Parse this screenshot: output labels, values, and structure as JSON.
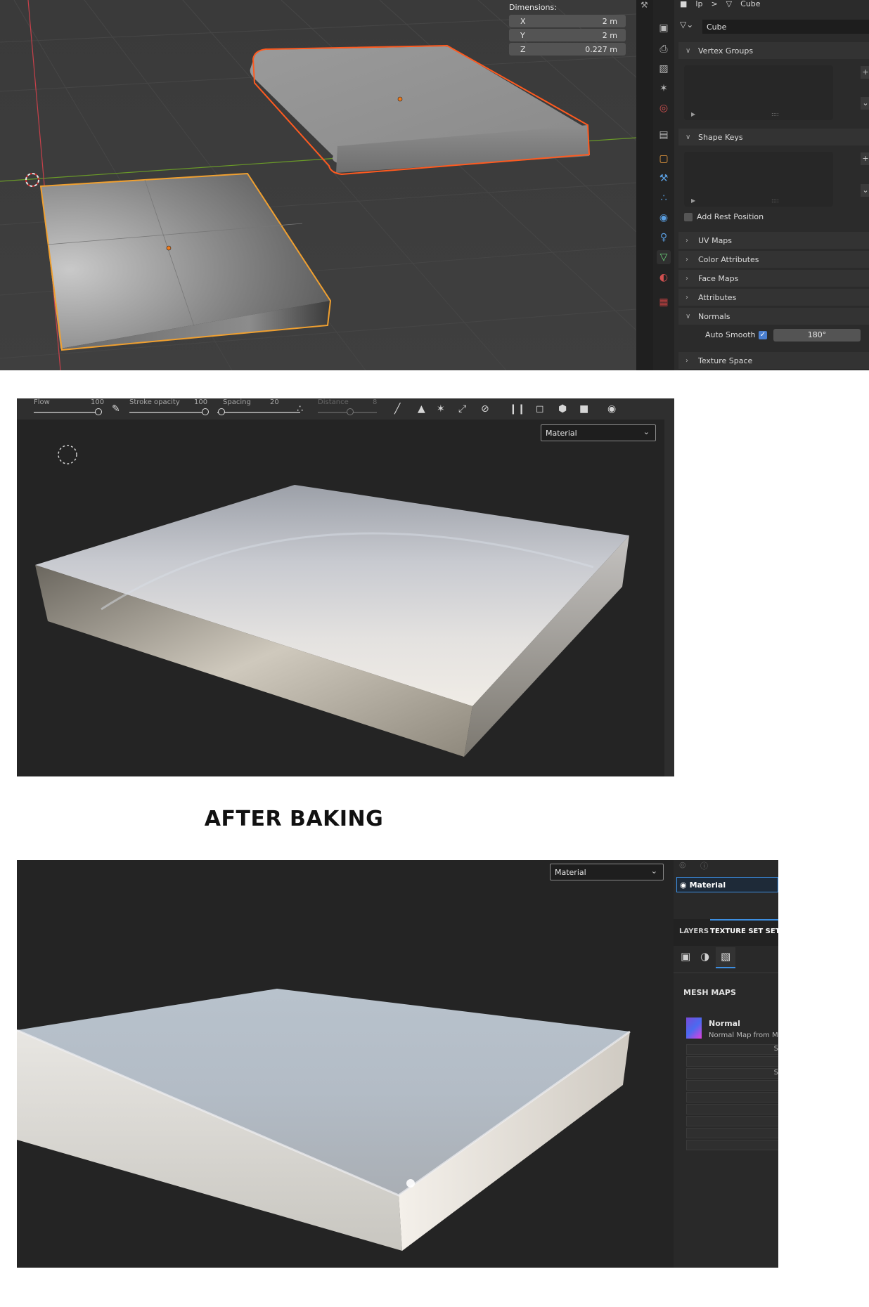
{
  "blender": {
    "dimensions": {
      "label": "Dimensions:",
      "rows": [
        {
          "axis": "X",
          "value": "2 m"
        },
        {
          "axis": "Y",
          "value": "2 m"
        },
        {
          "axis": "Z",
          "value": "0.227 m"
        }
      ]
    },
    "breadcrumb": {
      "object": "lp",
      "separator": ">",
      "data": "Cube"
    },
    "mesh_name": "Cube",
    "tab_icons": [
      "tool-icon",
      "render-icon",
      "output-icon",
      "view-layer-icon",
      "scene-icon",
      "world-icon",
      "collection-icon",
      "object-icon",
      "modifier-icon",
      "particles-icon",
      "physics-icon",
      "constraints-icon",
      "data-icon",
      "material-icon",
      "texture-icon"
    ],
    "panels": {
      "vertex_groups": "Vertex Groups",
      "shape_keys": "Shape Keys",
      "add_rest_position": "Add Rest Position",
      "uv_maps": "UV Maps",
      "color_attributes": "Color Attributes",
      "face_maps": "Face Maps",
      "attributes": "Attributes",
      "normals": "Normals",
      "auto_smooth_label": "Auto Smooth",
      "auto_smooth_checked": true,
      "auto_smooth_angle": "180°",
      "texture_space": "Texture Space"
    },
    "colors": {
      "selected_outline": "#f0a030",
      "active_outline": "#ff5a1f",
      "x_axis": "#c8404a",
      "y_axis": "#6a9a28",
      "active_tab": "#6cd67b",
      "checkbox": "#4a7fd0"
    }
  },
  "painter_before": {
    "toolbar": {
      "flow_label": "Flow",
      "flow_value": "100",
      "stroke_opacity_label": "Stroke opacity",
      "stroke_opacity_value": "100",
      "spacing_label": "Spacing",
      "spacing_value": "20",
      "distance_label": "Distance",
      "distance_value": "8",
      "icons": [
        "brush-icon",
        "symmetry-icon",
        "lazy-mouse-icon",
        "transform-icon",
        "perspective-icon",
        "pause-icon",
        "camera-view-icon",
        "cube-view-icon",
        "video-icon",
        "screenshot-icon"
      ]
    },
    "channel_dropdown": "Material"
  },
  "caption": "AFTER BAKING",
  "painter_after": {
    "channel_dropdown": "Material",
    "texture_set": {
      "name": "Material"
    },
    "tabs": {
      "layers": "LAYERS",
      "texture_set_settings": "TEXTURE SET SET"
    },
    "mesh_maps_header": "MESH MAPS",
    "normal_map": {
      "title": "Normal",
      "subtitle": "Normal Map from M"
    },
    "row_letters": [
      "S",
      "S"
    ],
    "accent_color": "#3d8ee0"
  }
}
